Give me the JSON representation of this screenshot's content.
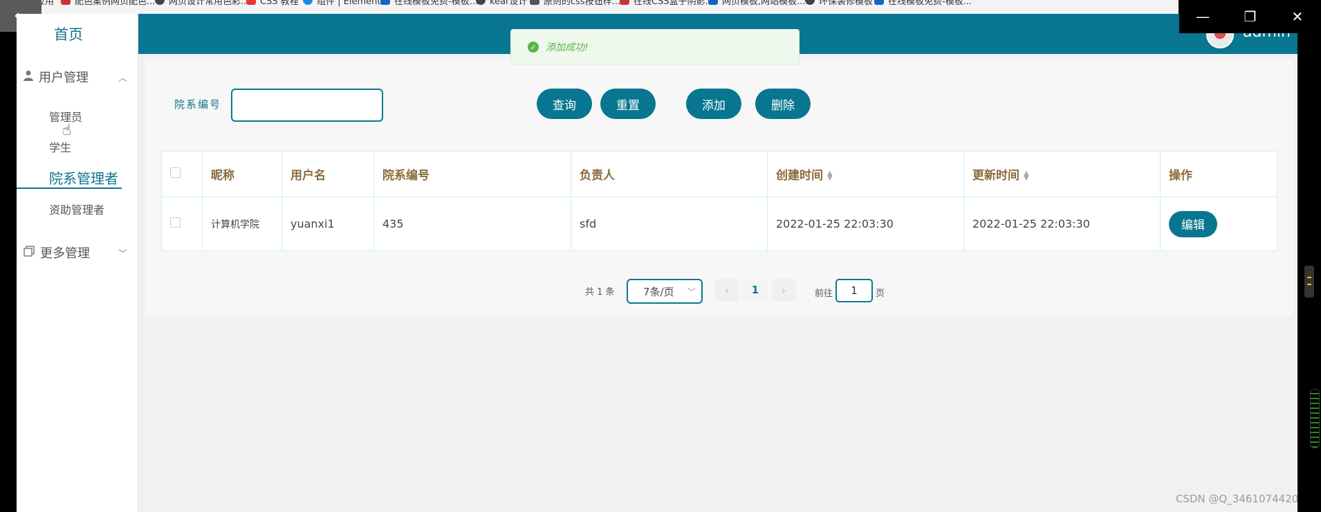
{
  "browser": {
    "bookmarks": [
      "应用",
      "配色案例网页配色...",
      "网页设计常用色彩...",
      "CSS 教程",
      "组件 | Element",
      "在线模板免费-模板...",
      "kear设计",
      "原则的css按钮样...",
      "在线CSS盒子阴影...",
      "网页模板,网站模板...",
      "环保装修模板",
      "在线模板免费-模板..."
    ]
  },
  "sidebar": {
    "home": "首页",
    "user_mgmt": "用户管理",
    "items": [
      "管理员",
      "学生",
      "院系管理者",
      "资助管理者"
    ],
    "more_mgmt": "更多管理"
  },
  "header": {
    "username": "admin"
  },
  "toast": {
    "message": "添加成功!"
  },
  "search": {
    "label": "院系编号",
    "value": ""
  },
  "buttons": {
    "query": "查询",
    "reset": "重置",
    "add": "添加",
    "delete": "删除"
  },
  "table": {
    "headers": [
      "昵称",
      "用户名",
      "院系编号",
      "负责人",
      "创建时间",
      "更新时间",
      "操作"
    ],
    "rows": [
      {
        "nickname": "计算机学院",
        "username": "yuanxi1",
        "dept_no": "435",
        "manager": "sfd",
        "created": "2022-01-25 22:03:30",
        "updated": "2022-01-25 22:03:30",
        "action": "编辑"
      }
    ]
  },
  "pagination": {
    "total": "共 1 条",
    "page_size": "7条/页",
    "current": "1",
    "goto_label": "前往",
    "goto_value": "1",
    "goto_unit": "页"
  },
  "watermark": "CSDN @Q_3461074420",
  "colors": {
    "primary": "#087691",
    "success": "#5bb54a",
    "header_text": "#8a6a3a"
  }
}
